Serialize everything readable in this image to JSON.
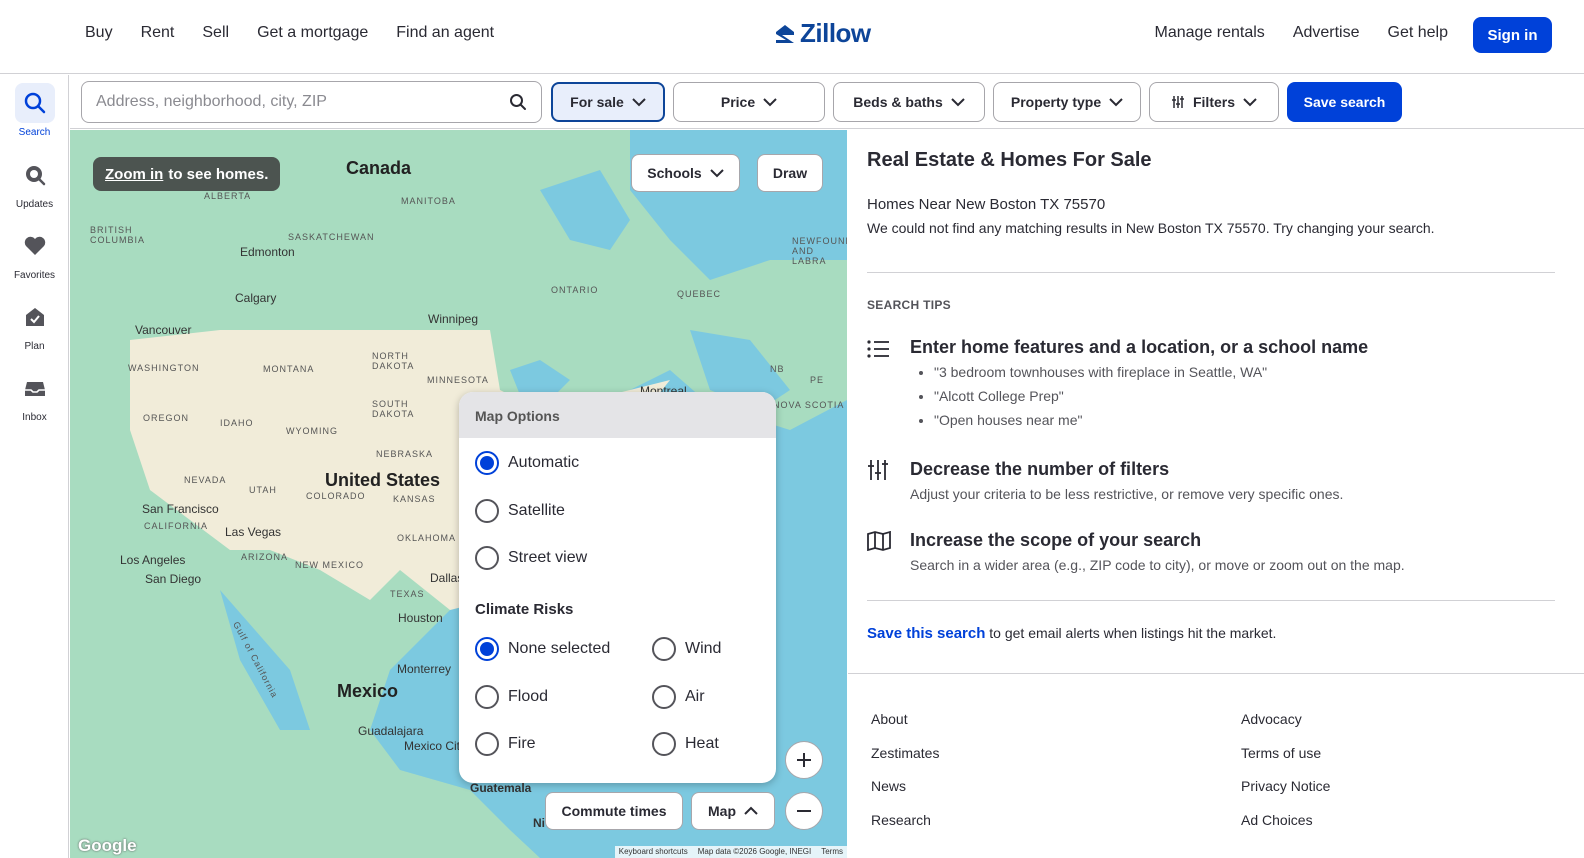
{
  "nav": {
    "left": [
      "Buy",
      "Rent",
      "Sell",
      "Get a mortgage",
      "Find an agent"
    ],
    "logo": "Zillow",
    "right": [
      "Manage rentals",
      "Advertise",
      "Get help"
    ],
    "signin": "Sign in"
  },
  "rail": [
    {
      "label": "Search",
      "icon": "search-icon"
    },
    {
      "label": "Updates",
      "icon": "updates-icon"
    },
    {
      "label": "Favorites",
      "icon": "heart-icon"
    },
    {
      "label": "Plan",
      "icon": "plan-icon"
    },
    {
      "label": "Inbox",
      "icon": "inbox-icon"
    }
  ],
  "filters": {
    "search_placeholder": "Address, neighborhood, city, ZIP",
    "for_sale": "For sale",
    "price": "Price",
    "beds_baths": "Beds & baths",
    "property_type": "Property type",
    "more": "Filters",
    "save_search": "Save search"
  },
  "map": {
    "zoom_link": "Zoom in",
    "zoom_rest": "to see homes.",
    "schools": "Schools",
    "draw": "Draw",
    "commute": "Commute times",
    "map_btn": "Map",
    "google": "Google",
    "attribution": [
      "Keyboard shortcuts",
      "Map data ©2026 Google, INEGI",
      "Terms"
    ],
    "countries": [
      "Canada",
      "United States",
      "Mexico"
    ],
    "regions": [
      "ALBERTA",
      "BRITISH COLUMBIA",
      "SASKATCHEWAN",
      "MANITOBA",
      "ONTARIO",
      "QUEBEC",
      "NEWFOUND AND LABRA",
      "WASHINGTON",
      "MONTANA",
      "NORTH DAKOTA",
      "MINNESOTA",
      "SOUTH DAKOTA",
      "OREGON",
      "IDAHO",
      "WYOMING",
      "NEBRASKA",
      "NEVADA",
      "UTAH",
      "COLORADO",
      "KANSAS",
      "CALIFORNIA",
      "ARIZONA",
      "NEW MEXICO",
      "OKLAHOMA",
      "TEXAS",
      "NB",
      "PE",
      "NOVA SCOTIA",
      "Gulf of California"
    ],
    "cities": [
      "Edmonton",
      "Calgary",
      "Vancouver",
      "Winnipeg",
      "Montreal",
      "San Francisco",
      "Las Vegas",
      "Los Angeles",
      "San Diego",
      "Dallas",
      "Houston",
      "Monterrey",
      "Guadalajara",
      "Mexico City",
      "Guatemala",
      "Ni"
    ],
    "options": {
      "title": "Map Options",
      "types": [
        {
          "label": "Automatic",
          "selected": true
        },
        {
          "label": "Satellite",
          "selected": false
        },
        {
          "label": "Street view",
          "selected": false
        }
      ],
      "climate_title": "Climate Risks",
      "climate": [
        {
          "label": "None selected",
          "selected": true
        },
        {
          "label": "Wind",
          "selected": false
        },
        {
          "label": "Flood",
          "selected": false
        },
        {
          "label": "Air",
          "selected": false
        },
        {
          "label": "Fire",
          "selected": false
        },
        {
          "label": "Heat",
          "selected": false
        }
      ]
    }
  },
  "results": {
    "title": "Real Estate & Homes For Sale",
    "near": "Homes Near New Boston TX 75570",
    "nomatch": "We could not find any matching results in New Boston TX 75570. Try changing your search.",
    "tips_title": "SEARCH TIPS",
    "tip1_h": "Enter home features and a location, or a school name",
    "tip1_items": [
      "\"3 bedroom townhouses with fireplace in Seattle, WA\"",
      "\"Alcott College Prep\"",
      "\"Open houses near me\""
    ],
    "tip2_h": "Decrease the number of filters",
    "tip2_p": "Adjust your criteria to be less restrictive, or remove very specific ones.",
    "tip3_h": "Increase the scope of your search",
    "tip3_p": "Search in a wider area (e.g., ZIP code to city), or move or zoom out on the map.",
    "save_link": "Save this search",
    "save_rest": " to get email alerts when listings hit the market.",
    "footer_left": [
      "About",
      "Zestimates",
      "News",
      "Research"
    ],
    "footer_right": [
      "Advocacy",
      "Terms of use",
      "Privacy Notice",
      "Ad Choices"
    ]
  },
  "colors": {
    "brand": "#0041d9",
    "text": "#2a2a33",
    "water": "#7cc9e0",
    "land": "#a8dcc0"
  }
}
